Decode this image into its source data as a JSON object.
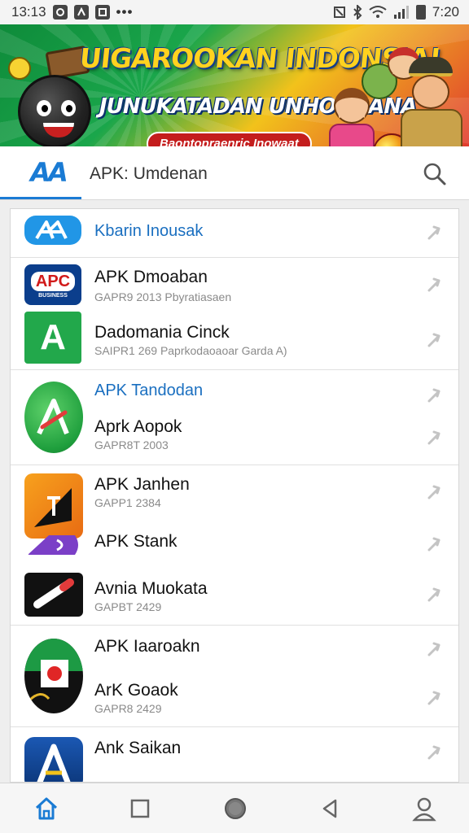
{
  "status_bar": {
    "time_left": "13:13",
    "time_right": "7:20",
    "left_icons": [
      "gallery-icon",
      "notification-icon",
      "shield-icon"
    ],
    "right_icons": [
      "nfc-icon",
      "bluetooth-icon",
      "wifi-icon",
      "signal-icon",
      "battery-icon"
    ]
  },
  "banner": {
    "title": "UIGAROOKAN INDONSIA!",
    "subtitle": "JUNUKATADAN UNHONRANA",
    "tag": "Baontopraenric Inowaat"
  },
  "header": {
    "title": "APK: Umdenan",
    "logo_text": "AA"
  },
  "list": {
    "items": [
      {
        "title": "Kbarin Inousak",
        "subtitle": "",
        "accent": true
      },
      {
        "title": "APK Dmoaban",
        "subtitle": "GAPR9 2013 Pbyratiasaen",
        "accent": false
      },
      {
        "title": "Dadomania Cinck",
        "subtitle": "SAIPR1 269 Paprkodaoaoar Garda A)",
        "accent": false
      },
      {
        "title": "APK Tandodan",
        "subtitle": "",
        "accent": true
      },
      {
        "title": "Aprk Aopok",
        "subtitle": "GAPR8T 2003",
        "accent": false
      },
      {
        "title": "APK Janhen",
        "subtitle": "GAPP1 2384",
        "accent": false
      },
      {
        "title": "APK Stank",
        "subtitle": "",
        "accent": false
      },
      {
        "title": "Avnia Muokata",
        "subtitle": "GAPBT 2429",
        "accent": false
      },
      {
        "title": "APK Iaaroakn",
        "subtitle": "",
        "accent": false
      },
      {
        "title": "ArK Goaok",
        "subtitle": "GAPR8 2429",
        "accent": false
      },
      {
        "title": "Ank Saikan",
        "subtitle": "",
        "accent": false
      }
    ],
    "icon_text": {
      "apc": "APC",
      "apc_small": "BUSINESS",
      "green_a": "A"
    }
  },
  "colors": {
    "accent": "#1a7bd4",
    "link": "#1a6fc0"
  },
  "bottom_nav": [
    "home-icon",
    "square-icon",
    "circle-icon",
    "back-icon",
    "profile-icon"
  ]
}
